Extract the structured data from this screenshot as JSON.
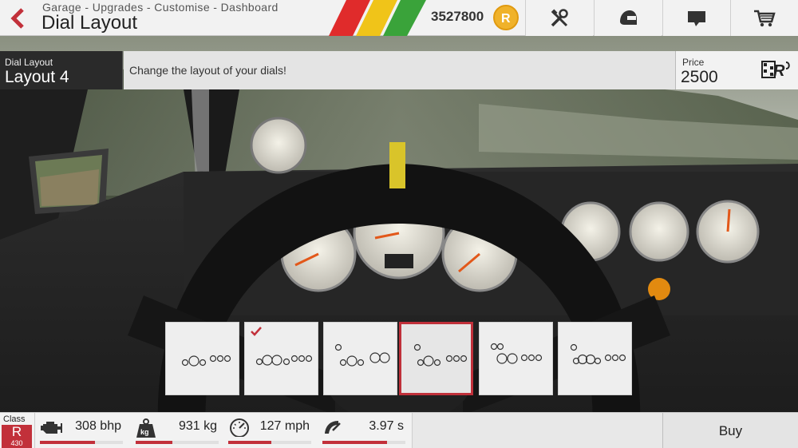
{
  "header": {
    "breadcrumb": "Garage - Upgrades - Customise - Dashboard",
    "title": "Dial Layout",
    "currency_amount": "3527800",
    "stripe_colors": [
      "#e02b2b",
      "#f0c419",
      "#3aa33a"
    ],
    "icons": [
      "back-icon",
      "tools-icon",
      "helmet-icon",
      "chat-icon",
      "cart-icon"
    ]
  },
  "info": {
    "layout_label": "Dial Layout",
    "layout_name": "Layout 4",
    "description": "Change the layout of your dials!",
    "price_label": "Price",
    "price_value": "2500"
  },
  "tiles": {
    "count": 6,
    "selected_index": 3,
    "owned_index": 1
  },
  "stats": {
    "class_label": "Class",
    "class_letter": "R",
    "class_rating": "430",
    "power": "308 bhp",
    "power_fill": 0.66,
    "weight": "931 kg",
    "weight_fill": 0.44,
    "top_speed": "127 mph",
    "speed_fill": 0.52,
    "acceleration": "3.97 s",
    "accel_fill": 0.78
  },
  "actions": {
    "buy_label": "Buy"
  },
  "colors": {
    "accent": "#c2303a",
    "coin": "#f0b22a"
  }
}
